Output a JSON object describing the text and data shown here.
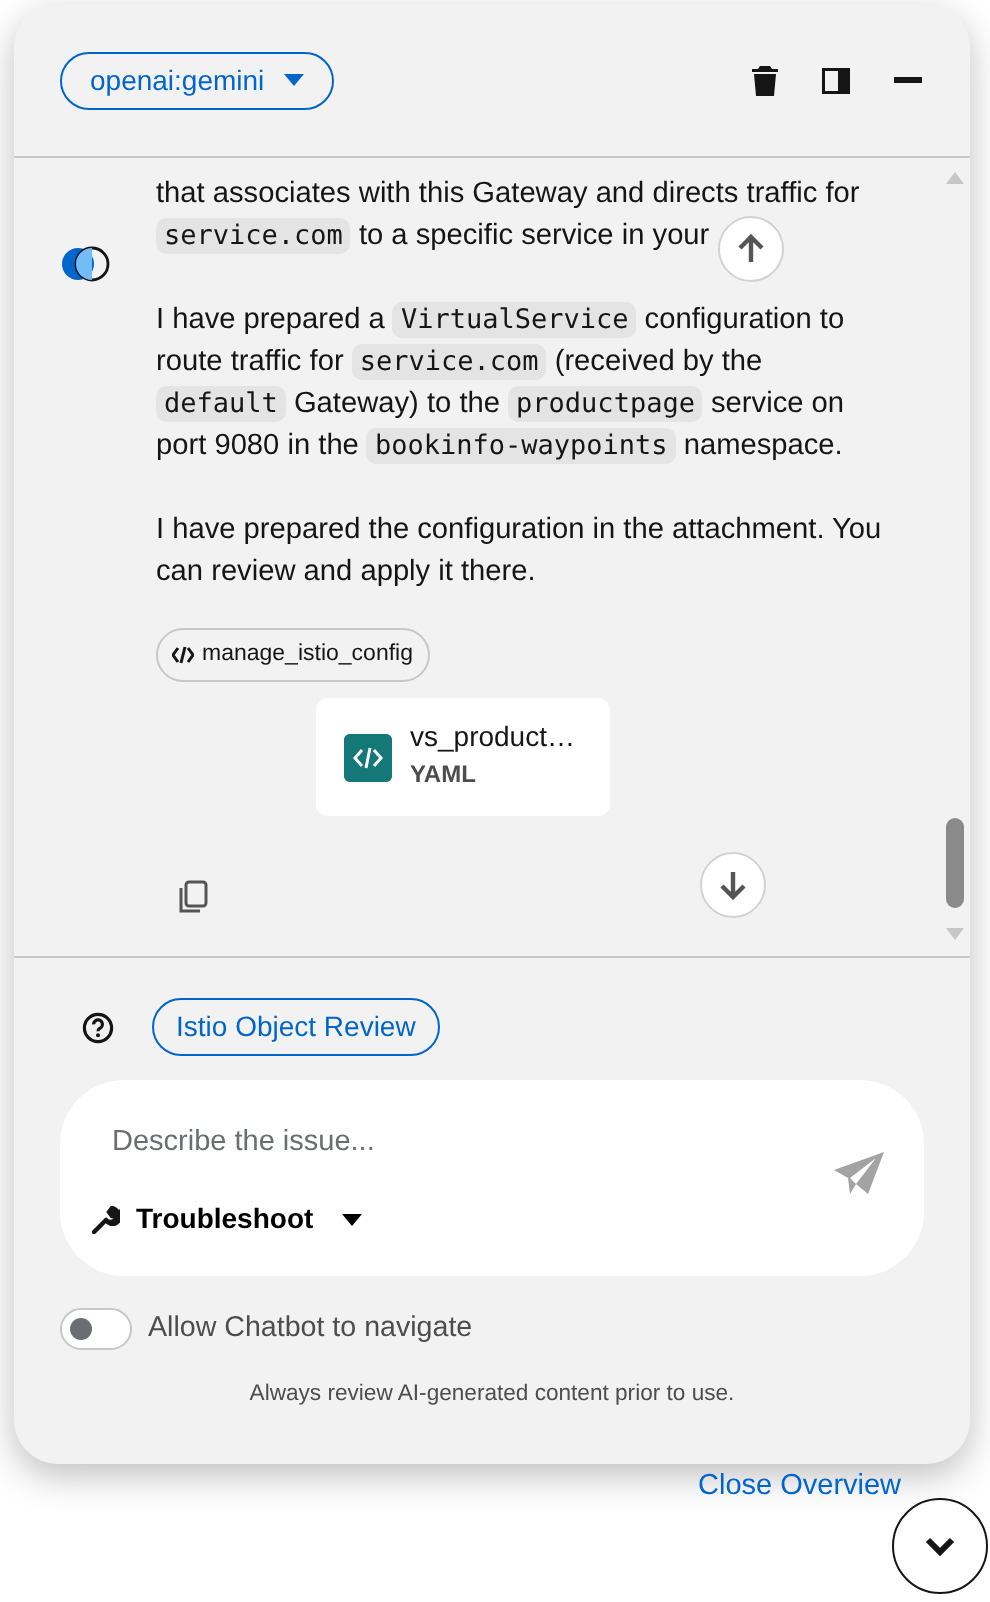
{
  "header": {
    "model_selector": "openai:gemini"
  },
  "message": {
    "paragraphs": [
      [
        {
          "kind": "text",
          "text": "that associates with this Gateway and directs traffic for "
        },
        {
          "kind": "code",
          "text": "service.com"
        },
        {
          "kind": "text",
          "text": " to a specific service in your"
        }
      ],
      [
        {
          "kind": "text",
          "text": "I have prepared a "
        },
        {
          "kind": "code",
          "text": "VirtualService"
        },
        {
          "kind": "text",
          "text": " configuration to route traffic for "
        },
        {
          "kind": "code",
          "text": "service.com"
        },
        {
          "kind": "text",
          "text": " (received by the "
        },
        {
          "kind": "code",
          "text": "default"
        },
        {
          "kind": "text",
          "text": " Gateway) to the "
        },
        {
          "kind": "code",
          "text": "productpage"
        },
        {
          "kind": "text",
          "text": " service on port 9080 in the "
        },
        {
          "kind": "code",
          "text": "bookinfo-waypoints"
        },
        {
          "kind": "text",
          "text": " namespace."
        }
      ],
      [
        {
          "kind": "text",
          "text": "I have prepared the configuration in the attachment. You can review and apply it there."
        }
      ]
    ],
    "tool_label": "manage_istio_config",
    "attachment": {
      "name": "vs_product…",
      "type": "YAML"
    }
  },
  "prompt_chip": "Istio Object Review",
  "input": {
    "placeholder": "Describe the issue...",
    "mode": "Troubleshoot"
  },
  "navigate_toggle": {
    "label": "Allow Chatbot to navigate",
    "on": false
  },
  "disclaimer": "Always review AI-generated content prior to use.",
  "close_link": "Close Overview"
}
